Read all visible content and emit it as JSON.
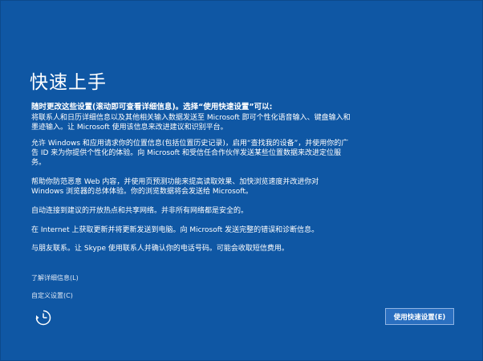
{
  "page": {
    "title": "快速上手",
    "subtitle": "随时更改这些设置(滚动即可查看详细信息)。选择“使用快速设置”可以:",
    "paragraphs": [
      {
        "lines": [
          "将联系人和日历详细信息以及其他相关输入数据发送至 Microsoft 即可个性化语音输入、键盘输入和",
          "墨迹输入。让 Microsoft 使用该信息来改进建议和识别平台。"
        ]
      },
      {
        "lines": [
          "允许 Windows 和应用请求你的位置信息(包括位置历史记录)，启用“查找我的设备”，并使用你的广",
          "告 ID 来为你提供个性化的体验。向 Microsoft 和受信任合作伙伴发送某些位置数据来改进定位服",
          "务。"
        ]
      },
      {
        "lines": [
          "帮助你防范恶意 Web 内容，并使用页预测功能来提高读取效果、加快浏览速度并改进你对",
          "Windows 浏览器的总体体验。你的浏览数据将会发送给 Microsoft。"
        ]
      },
      {
        "lines": [
          "自动连接到建议的开放热点和共享网络。并非所有网络都是安全的。"
        ]
      },
      {
        "lines": [
          "在 Internet 上获取更新并将更新发送到电脑。向 Microsoft 发送完整的错误和诊断信息。"
        ]
      },
      {
        "lines": [
          "与朋友联系。让 Skype 使用联系人并确认你的电话号码。可能会收取短信费用。"
        ]
      }
    ],
    "links": {
      "details": "了解详细信息(L)",
      "customize": "自定义设置(C)"
    },
    "accessibility_icon": "ease-of-access-icon",
    "express_button": "使用快速设置(E)"
  },
  "colors": {
    "background": "#0f57a4",
    "button": "#2a6fc0",
    "button_border": "#8fb4e3",
    "text": "#ffffff"
  }
}
